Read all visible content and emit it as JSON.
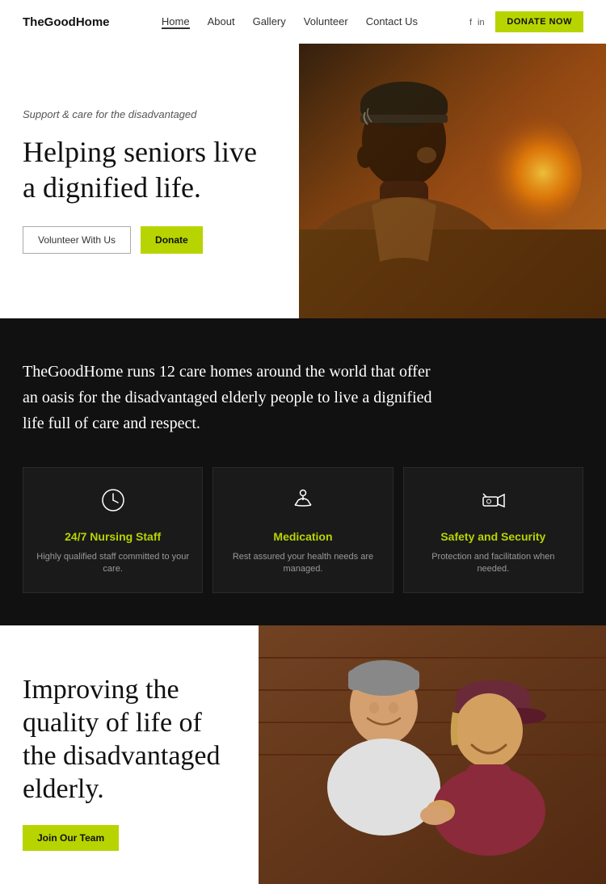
{
  "nav": {
    "logo": "TheGoodHome",
    "links": [
      {
        "label": "Home",
        "active": true
      },
      {
        "label": "About",
        "active": false
      },
      {
        "label": "Gallery",
        "active": false
      },
      {
        "label": "Volunteer",
        "active": false
      },
      {
        "label": "Contact Us",
        "active": false
      }
    ],
    "social": "f  in",
    "donate_label": "DONATE NOW"
  },
  "hero": {
    "tagline": "Support & care for the disadvantaged",
    "title": "Helping seniors live a dignified life.",
    "btn_volunteer": "Volunteer With Us",
    "btn_donate": "Donate"
  },
  "dark": {
    "description": "TheGoodHome runs 12 care homes around the world that offer an oasis for the disadvantaged elderly people to live a dignified life full of care and respect.",
    "features": [
      {
        "icon": "🕐",
        "title": "24/7 Nursing Staff",
        "desc": "Highly qualified staff committed to your care."
      },
      {
        "icon": "🧘",
        "title": "Medication",
        "desc": "Rest assured your health needs are managed."
      },
      {
        "icon": "📷",
        "title": "Safety and Security",
        "desc": "Protection and facilitation when needed."
      }
    ]
  },
  "bottom": {
    "title": "Improving the quality of life of the disadvantaged elderly.",
    "btn_join": "Join Our Team"
  }
}
